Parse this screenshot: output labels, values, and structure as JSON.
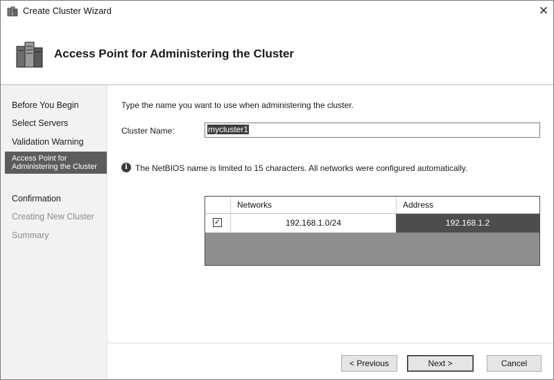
{
  "window": {
    "title": "Create Cluster Wizard",
    "close_glyph": "✕"
  },
  "header": {
    "title": "Access Point for Administering the Cluster"
  },
  "steps": [
    {
      "label": "Before You Begin",
      "state": "done"
    },
    {
      "label": "Select Servers",
      "state": "done"
    },
    {
      "label": "Validation Warning",
      "state": "done"
    },
    {
      "label": "Access Point for Administering the Cluster",
      "state": "active"
    },
    {
      "label": "Confirmation",
      "state": "pending"
    },
    {
      "label": "Creating New Cluster",
      "state": "disabled"
    },
    {
      "label": "Summary",
      "state": "disabled"
    }
  ],
  "main": {
    "instruction": "Type the name you want to use when administering the cluster.",
    "cluster_name_label": "Cluster Name:",
    "cluster_name_value": "mycluster1",
    "info_text": "The NetBIOS name is limited to 15 characters.  All networks were configured automatically."
  },
  "networks_table": {
    "columns": [
      "Networks",
      "Address"
    ],
    "rows": [
      {
        "checked": true,
        "network": "192.168.1.0/24",
        "address": "192.168.1.2"
      }
    ]
  },
  "buttons": {
    "previous": "< Previous",
    "next": "Next >",
    "cancel": "Cancel"
  },
  "icons": {
    "title": "cluster-icon",
    "header": "cluster-servers-icon",
    "info": "info-icon"
  },
  "colors": {
    "active_step_bg": "#5c5c5c",
    "selected_cell_bg": "#4d4d4d",
    "grid_empty_bg": "#8e8e8e"
  }
}
